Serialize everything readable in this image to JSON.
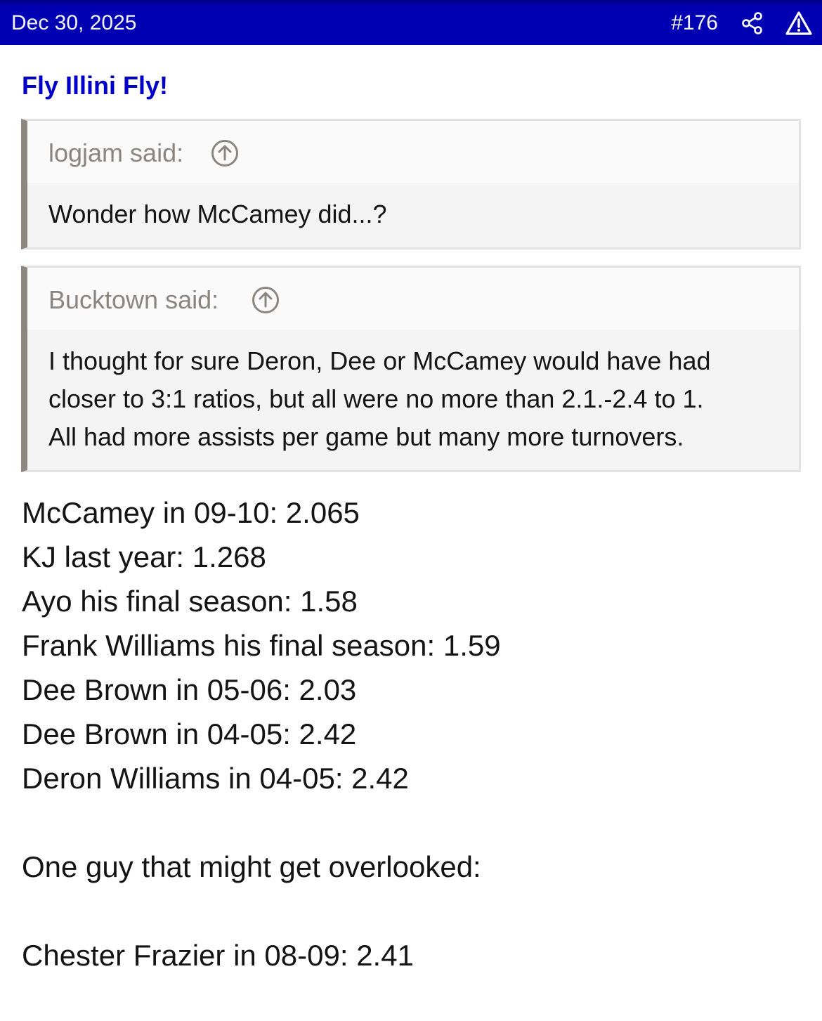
{
  "header": {
    "date": "Dec 30, 2025",
    "post_number": "#176",
    "share_icon": "share-icon",
    "report_icon": "warning-icon",
    "bar_color": "#0000b3"
  },
  "signature": {
    "title": "Fly Illini Fly!",
    "color": "#0000c8"
  },
  "quotes": [
    {
      "author": "logjam said:",
      "up_icon": "arrow-up-circle-icon",
      "text": "Wonder how McCamey did...?"
    },
    {
      "author": "Bucktown said:",
      "up_icon": "arrow-up-circle-icon",
      "lines": [
        "I thought for sure Deron, Dee or McCamey would have had",
        "closer to 3:1 ratios, but all were no more than 2.1.-2.4 to 1.",
        "All had more assists per game but many more turnovers."
      ]
    }
  ],
  "message": {
    "lines": [
      "McCamey in 09-10: 2.065",
      "KJ last year: 1.268",
      "Ayo his final season: 1.58",
      "Frank Williams his final season: 1.59",
      "Dee Brown in 05-06: 2.03",
      "Dee Brown in 04-05: 2.42",
      "Deron Williams in 04-05: 2.42"
    ],
    "overlooked_intro": "One guy that might get overlooked:",
    "overlooked_line": "Chester Frazier in 08-09: 2.41"
  }
}
